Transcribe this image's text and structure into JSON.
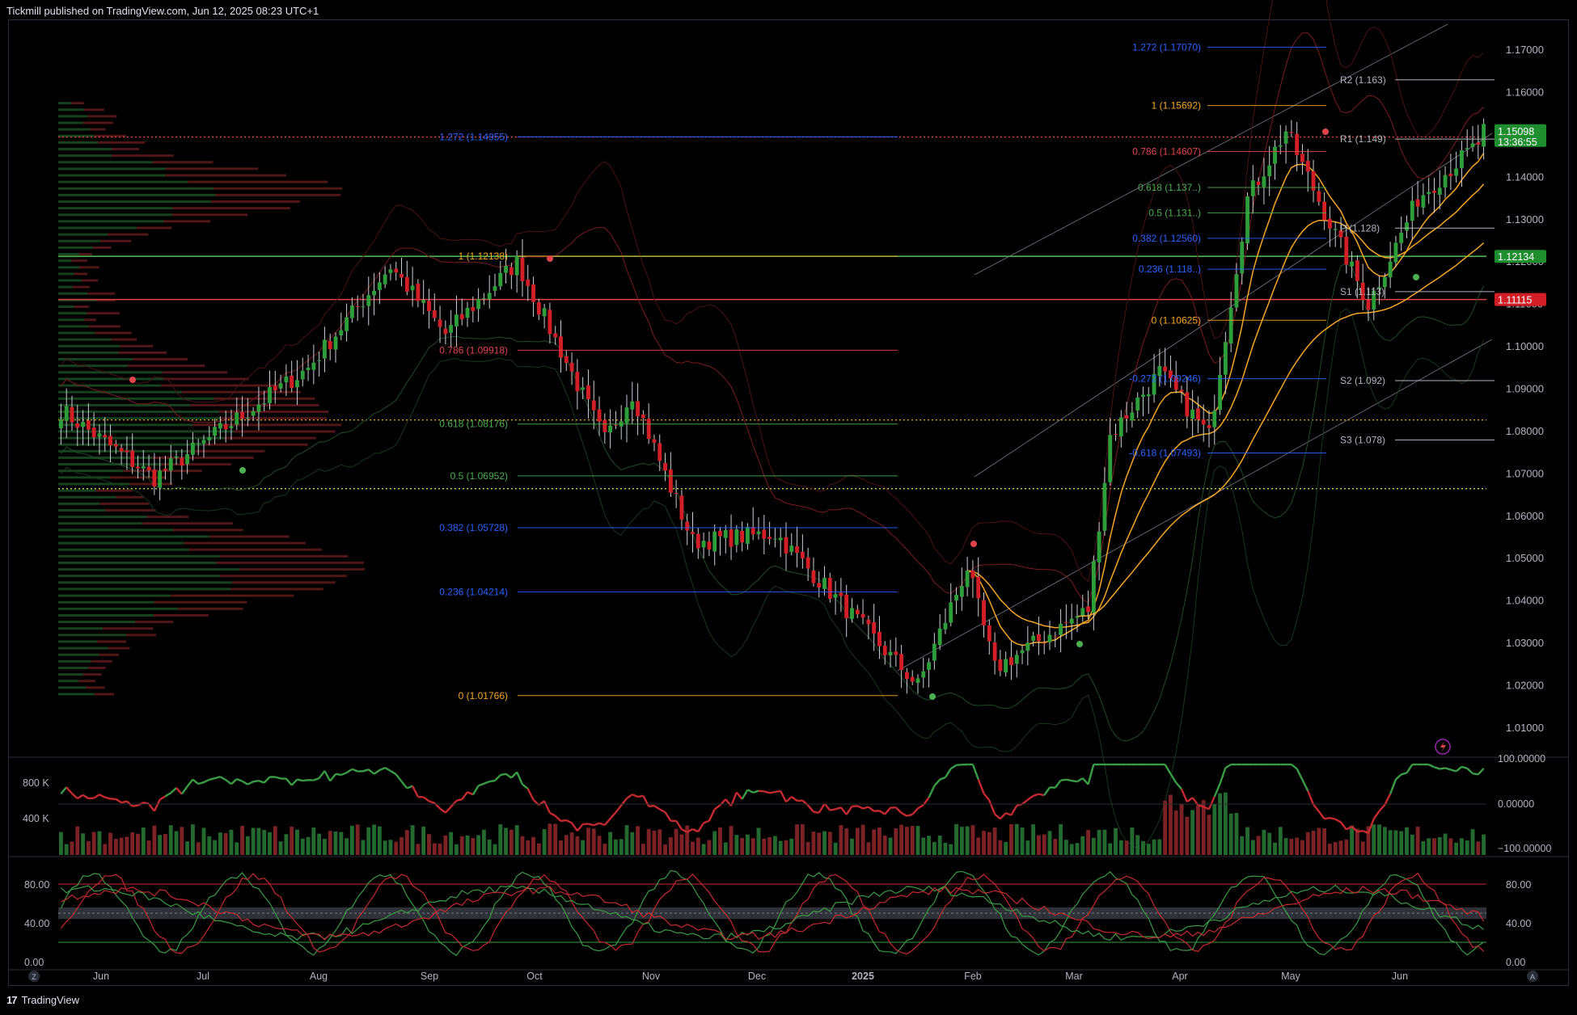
{
  "header": {
    "text": "Tickmill published on TradingView.com, Jun 12, 2025 08:23 UTC+1"
  },
  "footer": {
    "logo_text": "TradingView",
    "logo_mark": "17"
  },
  "colors": {
    "up": "#2e9e3b",
    "down": "#d21f27",
    "background": "#000000",
    "ema": "#f5a623",
    "fib_orange": "#f5a623",
    "fib_red": "#e2434b",
    "fib_green": "#4caf50",
    "fib_blue": "#2962ff"
  },
  "chart_data": [
    {
      "type": "candlestick",
      "name": "price",
      "y_axis_ticks": [
        "1.17000",
        "1.16000",
        "1.15000",
        "1.14000",
        "1.13000",
        "1.12000",
        "1.11000",
        "1.10000",
        "1.09000",
        "1.08000",
        "1.07000",
        "1.06000",
        "1.05000",
        "1.04000",
        "1.03000",
        "1.02000",
        "1.01000"
      ],
      "ylim": [
        1.0035,
        1.1765
      ],
      "x_axis_ticks": [
        "Jun",
        "Jul",
        "Aug",
        "Sep",
        "Oct",
        "Nov",
        "Dec",
        "2025",
        "Feb",
        "Mar",
        "Apr",
        "May",
        "Jun"
      ],
      "price_labels": [
        {
          "value": "1.15098",
          "sub": "13:36:55",
          "price": 1.15098,
          "color": "#1e8e2f"
        },
        {
          "value": "1.12134",
          "price": 1.12134,
          "color": "#1e8e2f"
        },
        {
          "value": "1.11115",
          "price": 1.11115,
          "color": "#d21f27"
        }
      ],
      "horizontal_lines": [
        {
          "price": 1.12134,
          "color": "#4caf50",
          "style": "solid"
        },
        {
          "price": 1.11115,
          "color": "#e2434b",
          "style": "solid"
        },
        {
          "price": 1.1495,
          "color": "#e2434b",
          "style": "dotted"
        },
        {
          "price": 1.0827,
          "color": "#f5a623",
          "style": "dotted"
        },
        {
          "price": 1.0665,
          "color": "#c8d64a",
          "style": "dotted"
        }
      ],
      "fib_1": [
        {
          "label": "1 (1.12138)",
          "price": 1.12138,
          "color": "#f5a623"
        },
        {
          "label": "0.786 (1.09918)",
          "price": 1.09918,
          "color": "#e2434b"
        },
        {
          "label": "0.618 (1.08176)",
          "price": 1.08176,
          "color": "#4caf50"
        },
        {
          "label": "0.5 (1.06952)",
          "price": 1.06952,
          "color": "#4caf50"
        },
        {
          "label": "0.382 (1.05728)",
          "price": 1.05728,
          "color": "#2962ff"
        },
        {
          "label": "0.236 (1.04214)",
          "price": 1.04214,
          "color": "#2962ff"
        },
        {
          "label": "0 (1.01766)",
          "price": 1.01766,
          "color": "#f5a623"
        },
        {
          "label": "1.272 (1.14955)",
          "price": 1.14955,
          "color": "#2962ff"
        }
      ],
      "fib_2": [
        {
          "label": "1.272 (1.17070)",
          "price": 1.1707,
          "color": "#2962ff"
        },
        {
          "label": "1 (1.15692)",
          "price": 1.15692,
          "color": "#f5a623"
        },
        {
          "label": "0.786 (1.14607)",
          "price": 1.14607,
          "color": "#e2434b"
        },
        {
          "label": "0.618 (1.137..)",
          "price": 1.1376,
          "color": "#4caf50"
        },
        {
          "label": "0.5 (1.131..)",
          "price": 1.1316,
          "color": "#4caf50"
        },
        {
          "label": "0.382 (1.12560)",
          "price": 1.1256,
          "color": "#2962ff"
        },
        {
          "label": "0.236 (1.118..)",
          "price": 1.1183,
          "color": "#2962ff"
        },
        {
          "label": "0 (1.10625)",
          "price": 1.10625,
          "color": "#f5a623"
        },
        {
          "label": "-0.272 (1.09246)",
          "price": 1.09246,
          "color": "#2962ff"
        },
        {
          "label": "-0.618 (1.07493)",
          "price": 1.07493,
          "color": "#2962ff"
        }
      ],
      "pivots": [
        {
          "label": "R2 (1.163)",
          "price": 1.163
        },
        {
          "label": "R1 (1.149)",
          "price": 1.149
        },
        {
          "label": "P (1.128)",
          "price": 1.128
        },
        {
          "label": "S1 (1.113)",
          "price": 1.113
        },
        {
          "label": "S2 (1.092)",
          "price": 1.092
        },
        {
          "label": "S3 (1.078)",
          "price": 1.078
        }
      ],
      "candles_summary": {
        "count": 260,
        "key_closes": [
          {
            "date": "2024-06-01",
            "close": 1.085
          },
          {
            "date": "2024-06-26",
            "close": 1.069
          },
          {
            "date": "2024-08-05",
            "close": 1.095
          },
          {
            "date": "2024-08-27",
            "close": 1.119
          },
          {
            "date": "2024-09-10",
            "close": 1.103
          },
          {
            "date": "2024-09-30",
            "close": 1.12
          },
          {
            "date": "2024-10-23",
            "close": 1.078
          },
          {
            "date": "2024-10-30",
            "close": 1.089
          },
          {
            "date": "2024-11-15",
            "close": 1.054
          },
          {
            "date": "2024-12-06",
            "close": 1.056
          },
          {
            "date": "2025-01-13",
            "close": 1.02
          },
          {
            "date": "2025-01-27",
            "close": 1.048
          },
          {
            "date": "2025-02-03",
            "close": 1.024
          },
          {
            "date": "2025-02-28",
            "close": 1.038
          },
          {
            "date": "2025-03-05",
            "close": 1.079
          },
          {
            "date": "2025-03-18",
            "close": 1.094
          },
          {
            "date": "2025-03-31",
            "close": 1.079
          },
          {
            "date": "2025-04-11",
            "close": 1.135
          },
          {
            "date": "2025-04-21",
            "close": 1.151
          },
          {
            "date": "2025-05-12",
            "close": 1.11
          },
          {
            "date": "2025-05-26",
            "close": 1.135
          },
          {
            "date": "2025-06-11",
            "close": 1.148
          },
          {
            "date": "2025-06-12",
            "close": 1.15098
          }
        ]
      }
    },
    {
      "type": "bar+line",
      "name": "volume_and_oscillator",
      "left_axis_ticks": [
        "800 K",
        "400 K"
      ],
      "right_axis_ticks": [
        "100.00000",
        "0.00000",
        "−100.00000"
      ]
    },
    {
      "type": "line",
      "name": "stochastic",
      "left_axis_ticks": [
        "80.00",
        "40.00",
        "0.00"
      ],
      "right_axis_ticks": [
        "80.00",
        "40.00",
        "0.00"
      ],
      "levels": [
        80,
        50,
        20
      ]
    }
  ],
  "corner": {
    "left_button": "Z",
    "right_button": "A"
  }
}
